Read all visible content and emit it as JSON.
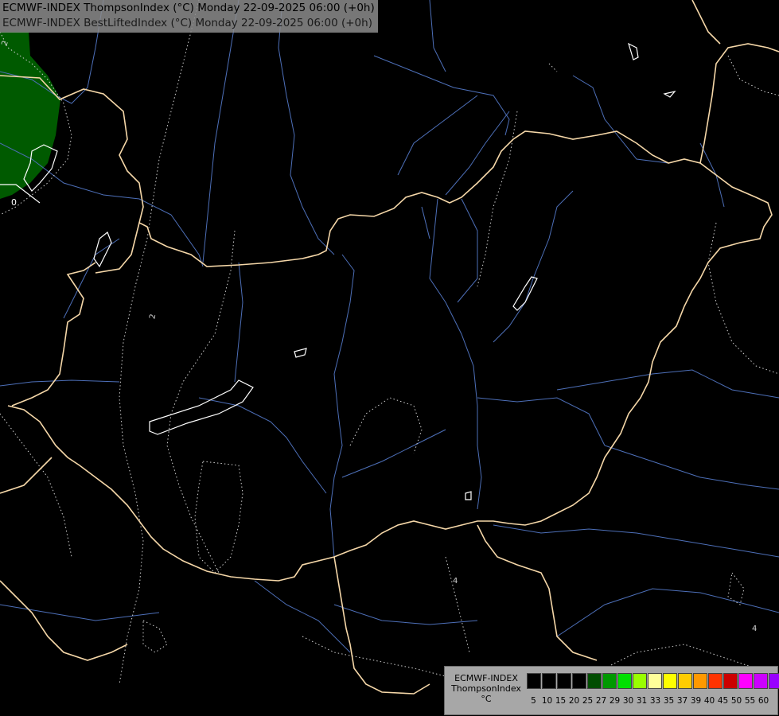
{
  "title": {
    "line1": "ECMWF-INDEX ThompsonIndex (°C) Monday 22-09-2025 06:00 (+0h)",
    "line2": "ECMWF-INDEX BestLiftedIndex (°C) Monday 22-09-2025 06:00 (+0h)"
  },
  "legend": {
    "model": "ECMWF-INDEX",
    "param": "ThompsonIndex",
    "unit": "°C",
    "ticks": [
      "5",
      "10",
      "15",
      "20",
      "25",
      "27",
      "29",
      "30",
      "31",
      "33",
      "35",
      "37",
      "39",
      "40",
      "45",
      "50",
      "55",
      "60"
    ],
    "colors": [
      "#000000",
      "#000000",
      "#000000",
      "#000000",
      "#004d00",
      "#009900",
      "#00e000",
      "#99ff00",
      "#ffff99",
      "#ffff00",
      "#ffcc00",
      "#ff9900",
      "#ff3300",
      "#cc0000",
      "#ff00ff",
      "#cc00ff",
      "#9900ff",
      "#3300ff"
    ]
  },
  "contour_labels": [
    "2",
    "0",
    "2",
    "4",
    "4"
  ],
  "colors": {
    "background": "#000000",
    "border": "#f5d7a8",
    "river": "#4d6fb8",
    "contour": "#cfcfcf",
    "positive_area": "#005a00"
  }
}
